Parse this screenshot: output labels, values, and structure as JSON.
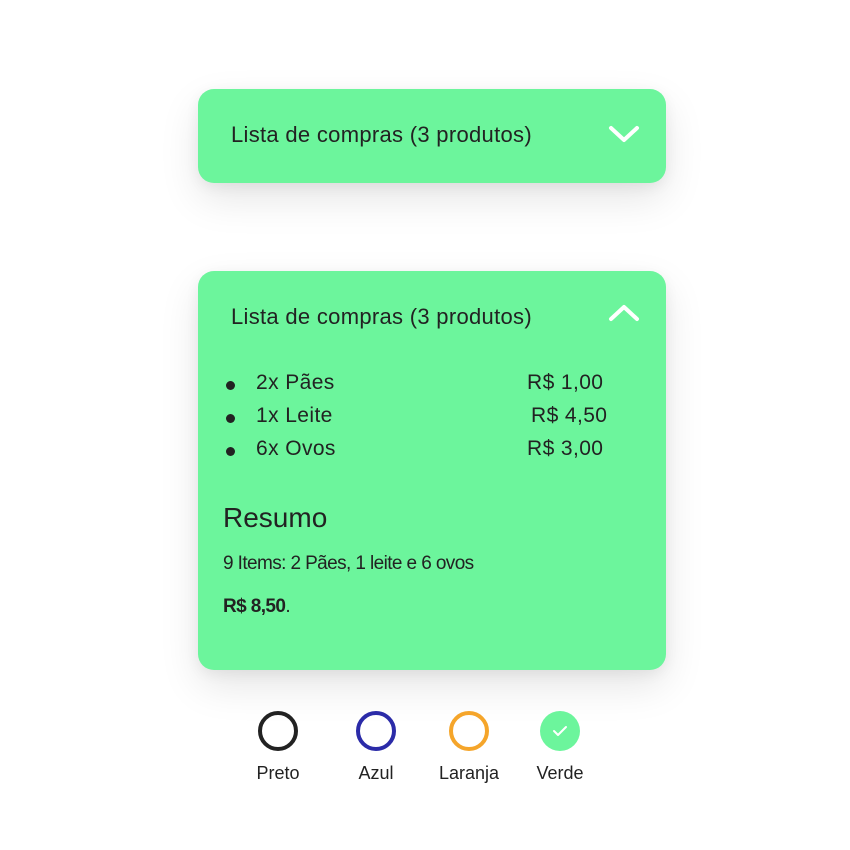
{
  "accordion_collapsed": {
    "title": "Lista de compras (3 produtos)",
    "icon": "chevron-down-icon"
  },
  "accordion_expanded": {
    "title": "Lista de compras (3 produtos)",
    "icon": "chevron-up-icon",
    "items": [
      {
        "name": "2x Pães",
        "price": "R$ 1,00"
      },
      {
        "name": "1x Leite",
        "price": "R$ 4,50"
      },
      {
        "name": "6x Ovos",
        "price": "R$ 3,00"
      }
    ],
    "summary": {
      "title": "Resumo",
      "description": "9 Items: 2 Pães, 1 leite e 6 ovos",
      "total": "R$ 8,50",
      "total_suffix": "."
    }
  },
  "colors": {
    "card_bg": "#6cf59c",
    "text": "#222222"
  },
  "color_options": [
    {
      "label": "Preto",
      "color": "#222222",
      "selected": false
    },
    {
      "label": "Azul",
      "color": "#2b2ba8",
      "selected": false
    },
    {
      "label": "Laranja",
      "color": "#f5a52a",
      "selected": false
    },
    {
      "label": "Verde",
      "color": "#6cf59c",
      "selected": true
    }
  ]
}
